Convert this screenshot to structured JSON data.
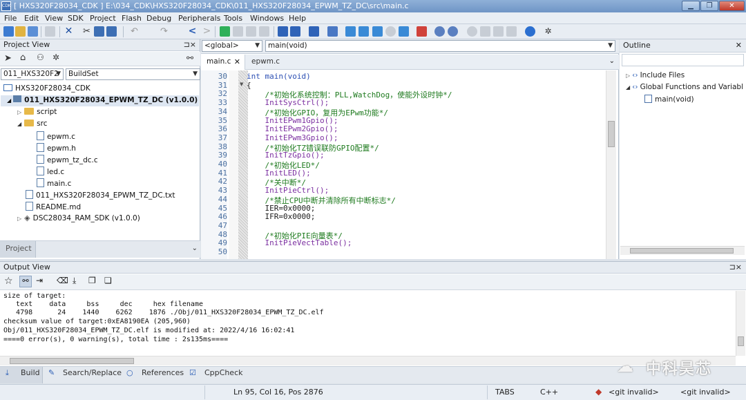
{
  "window": {
    "app_icon_text": "CDK",
    "title": "[ HXS320F28034_CDK ] E:\\034_CDK\\HXS320F28034_CDK\\011_HXS320F28034_EPWM_TZ_DC\\src\\main.c",
    "controls": [
      "minimize",
      "restore",
      "close"
    ]
  },
  "menu": [
    "File",
    "Edit",
    "View",
    "SDK",
    "Project",
    "Flash",
    "Debug",
    "Peripherals",
    "Tools",
    "Windows",
    "Help"
  ],
  "project_view": {
    "title": "Project View",
    "pin_glyph": "⊐×",
    "project_select": "011_HXS320F2",
    "config_select": "BuildSet",
    "tree": [
      {
        "label": "HXS320F28034_CDK",
        "type": "workspace"
      },
      {
        "label": "011_HXS320F28034_EPWM_TZ_DC (v1.0.0)",
        "type": "project",
        "bold": true
      },
      {
        "label": "script",
        "type": "folder"
      },
      {
        "label": "src",
        "type": "folder"
      },
      {
        "label": "epwm.c",
        "type": "file"
      },
      {
        "label": "epwm.h",
        "type": "file"
      },
      {
        "label": "epwm_tz_dc.c",
        "type": "file"
      },
      {
        "label": "led.c",
        "type": "file"
      },
      {
        "label": "main.c",
        "type": "file"
      },
      {
        "label": "011_HXS320F28034_EPWM_TZ_DC.txt",
        "type": "file"
      },
      {
        "label": "README.md",
        "type": "file"
      },
      {
        "label": "DSC28034_RAM_SDK (v1.0.0)",
        "type": "package"
      }
    ],
    "bottom_tab": "Project"
  },
  "editor": {
    "scope_select": "<global>",
    "function_select": "main(void)",
    "tabs": [
      {
        "label": "main.c",
        "active": true
      },
      {
        "label": "epwm.c",
        "active": false
      }
    ],
    "lines": [
      {
        "n": "30",
        "t": "int main(void)",
        "c": "kw"
      },
      {
        "n": "31",
        "t": "{",
        "c": "tx"
      },
      {
        "n": "32",
        "t": "    /*初始化系统控制：PLL,WatchDog，使能外设时钟*/",
        "c": "cm"
      },
      {
        "n": "33",
        "t": "    InitSysCtrl();",
        "c": "fn"
      },
      {
        "n": "34",
        "t": "    /*初始化GPIO，复用为EPwm功能*/",
        "c": "cm"
      },
      {
        "n": "35",
        "t": "    InitEPwm1Gpio();",
        "c": "fn"
      },
      {
        "n": "36",
        "t": "    InitEPwm2Gpio();",
        "c": "fn"
      },
      {
        "n": "37",
        "t": "    InitEPwm3Gpio();",
        "c": "fn"
      },
      {
        "n": "38",
        "t": "    /*初始化TZ错误联防GPIO配置*/",
        "c": "cm"
      },
      {
        "n": "39",
        "t": "    InitTzGpio();",
        "c": "fn"
      },
      {
        "n": "40",
        "t": "    /*初始化LED*/",
        "c": "cm"
      },
      {
        "n": "41",
        "t": "    InitLED();",
        "c": "fn"
      },
      {
        "n": "42",
        "t": "    /*关中断*/",
        "c": "cm"
      },
      {
        "n": "43",
        "t": "    InitPieCtrl();",
        "c": "fn"
      },
      {
        "n": "44",
        "t": "    /*禁止CPU中断并清除所有中断标志*/",
        "c": "cm"
      },
      {
        "n": "45",
        "t": "    IER=0x0000;",
        "c": "tx"
      },
      {
        "n": "46",
        "t": "    IFR=0x0000;",
        "c": "tx"
      },
      {
        "n": "47",
        "t": "",
        "c": "tx"
      },
      {
        "n": "48",
        "t": "    /*初始化PIE向量表*/",
        "c": "cm"
      },
      {
        "n": "49",
        "t": "    InitPieVectTable();",
        "c": "fn"
      },
      {
        "n": "50",
        "t": "",
        "c": "tx"
      }
    ]
  },
  "outline": {
    "title": "Outline",
    "items": [
      {
        "label": "Include Files"
      },
      {
        "label": "Global Functions and Variabl"
      },
      {
        "label": "main(void)"
      }
    ]
  },
  "output": {
    "title": "Output View",
    "lines": [
      "size of target:",
      "   text    data     bss     dec     hex filename",
      "   4798      24    1440    6262    1876 ./Obj/011_HXS320F28034_EPWM_TZ_DC.elf",
      "checksum value of target:0xEA8190EA (205,960)",
      "Obj/011_HXS320F28034_EPWM_TZ_DC.elf is modified at: 2022/4/16 16:02:41",
      "====0 error(s), 0 warning(s), total time : 2s135ms===="
    ],
    "tabs": [
      "Build",
      "Search/Replace",
      "References",
      "CppCheck"
    ]
  },
  "statusbar": {
    "position": "Ln 95, Col 16, Pos 2876",
    "tabs_mode": "TABS",
    "language": "C++",
    "git1": "<git invalid>",
    "git2": "<git invalid>"
  },
  "watermark": "中科昊芯",
  "colors": {
    "comment": "#1e7a1e",
    "function": "#7b2fa0",
    "keyword": "#2c4fb3",
    "title_bar": "#7a9dcc",
    "close_button": "#c0392b"
  }
}
